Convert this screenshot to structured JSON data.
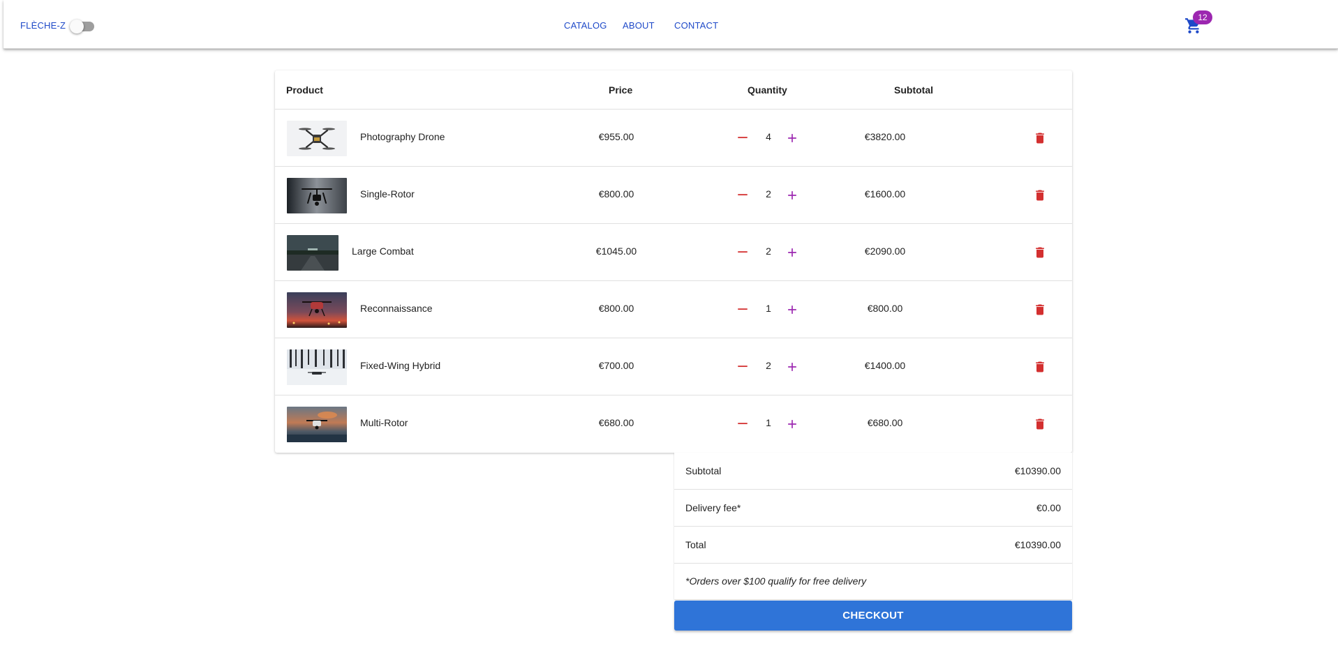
{
  "header": {
    "brand": "FLÈCHE-Z",
    "nav": [
      {
        "label": "CATALOG"
      },
      {
        "label": "ABOUT"
      },
      {
        "label": "CONTACT"
      }
    ],
    "cart_count": "12",
    "cart_icon": "shopping-cart-icon",
    "accent_color": "#1e49c8",
    "badge_color": "#9c27b0"
  },
  "table": {
    "headers": {
      "product": "Product",
      "price": "Price",
      "quantity": "Quantity",
      "subtotal": "Subtotal"
    },
    "rows": [
      {
        "name": "Photography Drone",
        "price": "€955.00",
        "qty": "4",
        "subtotal": "€3820.00"
      },
      {
        "name": "Single-Rotor",
        "price": "€800.00",
        "qty": "2",
        "subtotal": "€1600.00"
      },
      {
        "name": "Large Combat",
        "price": "€1045.00",
        "qty": "2",
        "subtotal": "€2090.00"
      },
      {
        "name": "Reconnaissance",
        "price": "€800.00",
        "qty": "1",
        "subtotal": "€800.00"
      },
      {
        "name": "Fixed-Wing Hybrid",
        "price": "€700.00",
        "qty": "2",
        "subtotal": "€1400.00"
      },
      {
        "name": "Multi-Rotor",
        "price": "€680.00",
        "qty": "1",
        "subtotal": "€680.00"
      }
    ],
    "icons": {
      "decrease": "minus-icon",
      "increase": "plus-icon",
      "remove": "trash-icon"
    },
    "colors": {
      "decrease": "#d32f2f",
      "increase": "#9c27b0",
      "remove": "#d32f2f"
    }
  },
  "summary": {
    "subtotal_label": "Subtotal",
    "subtotal_value": "€10390.00",
    "delivery_label": "Delivery fee*",
    "delivery_value": "€0.00",
    "total_label": "Total",
    "total_value": "€10390.00",
    "note": "*Orders over $100 qualify for free delivery"
  },
  "checkout": {
    "label": "CHECKOUT",
    "color": "#2f74d8"
  }
}
